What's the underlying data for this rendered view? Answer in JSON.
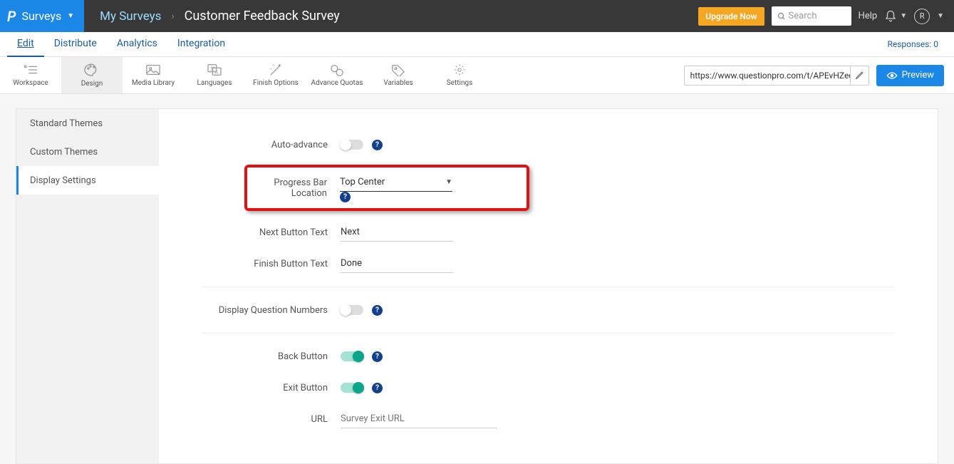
{
  "topbar": {
    "surveys_menu": "Surveys",
    "breadcrumb_link": "My Surveys",
    "breadcrumb_title": "Customer Feedback Survey",
    "upgrade": "Upgrade Now",
    "search_placeholder": "Search",
    "help": "Help",
    "avatar_letter": "R"
  },
  "tabs": {
    "edit": "Edit",
    "distribute": "Distribute",
    "analytics": "Analytics",
    "integration": "Integration",
    "responses": "Responses: 0"
  },
  "tools": {
    "workspace": "Workspace",
    "design": "Design",
    "media_library": "Media Library",
    "languages": "Languages",
    "finish_options": "Finish Options",
    "advance_quotas": "Advance Quotas",
    "variables": "Variables",
    "settings": "Settings",
    "url": "https://www.questionpro.com/t/APEvHZeq",
    "preview": "Preview"
  },
  "sidebar": {
    "standard_themes": "Standard Themes",
    "custom_themes": "Custom Themes",
    "display_settings": "Display Settings"
  },
  "form": {
    "auto_advance": "Auto-advance",
    "progress_bar_location_label": "Progress Bar Location",
    "progress_bar_location_value": "Top Center",
    "next_button_text_label": "Next Button Text",
    "next_button_text_value": "Next",
    "finish_button_text_label": "Finish Button Text",
    "finish_button_text_value": "Done",
    "display_question_numbers": "Display Question Numbers",
    "back_button": "Back Button",
    "exit_button": "Exit Button",
    "url_label": "URL",
    "url_placeholder": "Survey Exit URL"
  }
}
